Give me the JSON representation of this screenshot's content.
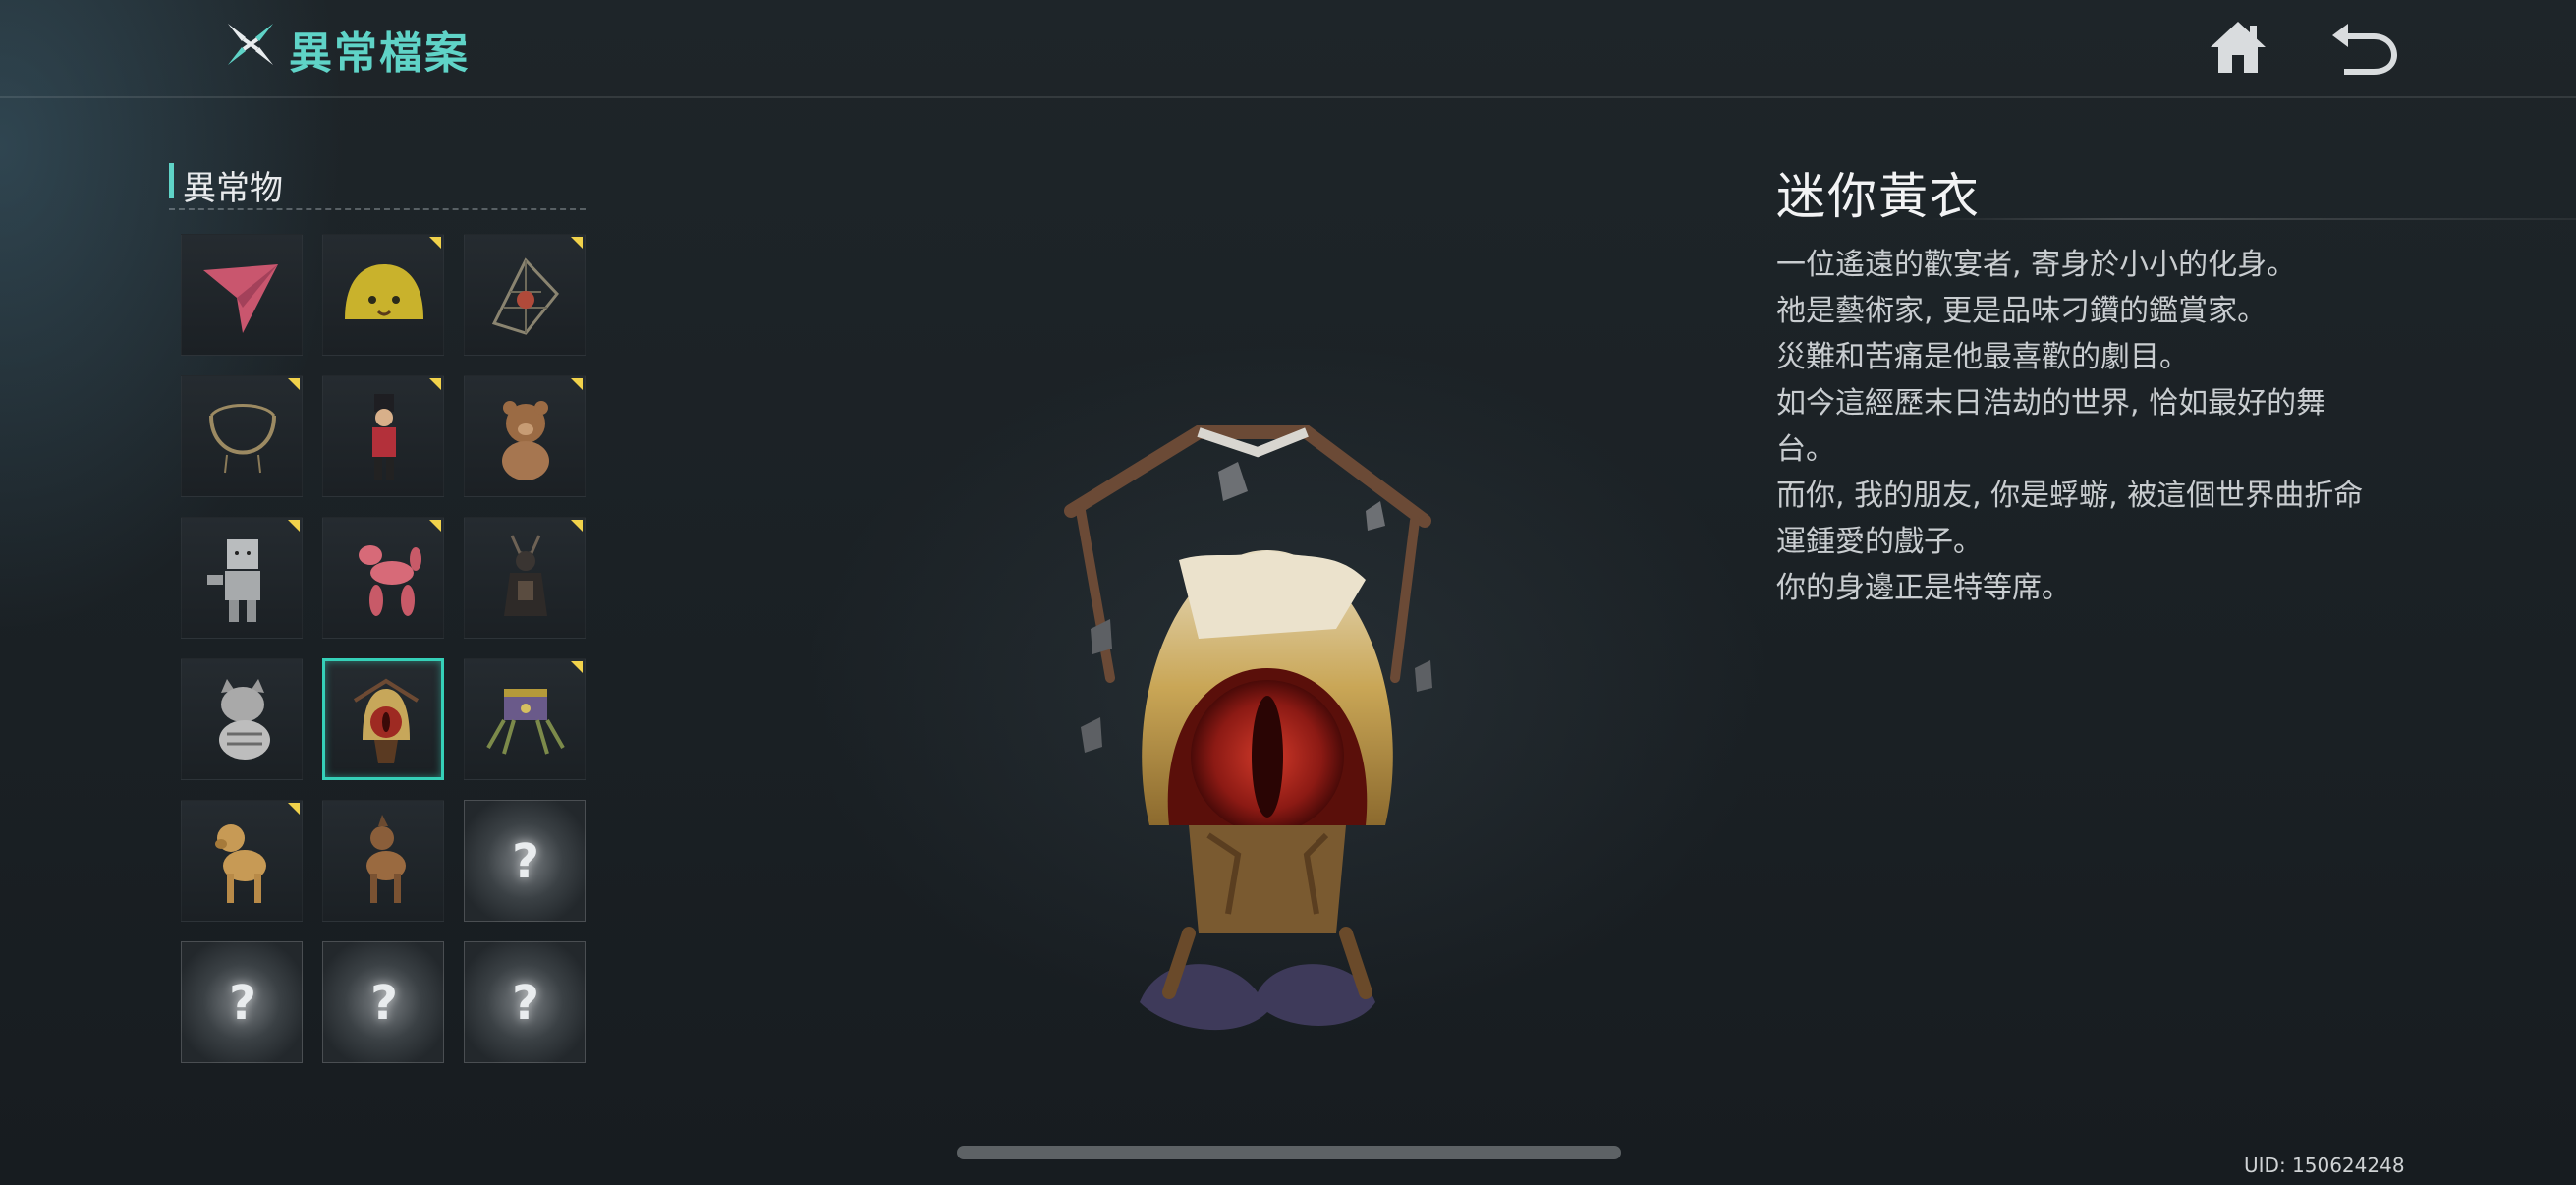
{
  "header": {
    "title": "異常檔案",
    "accent_color": "#5fd3c7",
    "logo_icon": "crossed-blades-icon",
    "home_icon": "home-icon",
    "back_icon": "back-arrow-icon"
  },
  "sidebar": {
    "category_label": "異常物",
    "items": [
      {
        "icon": "paper-plane-icon",
        "new": false,
        "locked": false,
        "selected": false
      },
      {
        "icon": "yellow-blob-icon",
        "new": true,
        "locked": false,
        "selected": false
      },
      {
        "icon": "lantern-cage-icon",
        "new": true,
        "locked": false,
        "selected": false
      },
      {
        "icon": "necklace-icon",
        "new": true,
        "locked": false,
        "selected": false
      },
      {
        "icon": "nutcracker-soldier-icon",
        "new": true,
        "locked": false,
        "selected": false
      },
      {
        "icon": "teddy-bear-icon",
        "new": true,
        "locked": false,
        "selected": false
      },
      {
        "icon": "box-robot-icon",
        "new": true,
        "locked": false,
        "selected": false
      },
      {
        "icon": "balloon-dog-icon",
        "new": true,
        "locked": false,
        "selected": false
      },
      {
        "icon": "dark-figure-icon",
        "new": true,
        "locked": false,
        "selected": false
      },
      {
        "icon": "tabby-cat-icon",
        "new": false,
        "locked": false,
        "selected": false
      },
      {
        "icon": "mini-yellow-robe-icon",
        "new": false,
        "locked": false,
        "selected": true
      },
      {
        "icon": "treasure-spider-icon",
        "new": true,
        "locked": false,
        "selected": false
      },
      {
        "icon": "labrador-dog-icon",
        "new": true,
        "locked": false,
        "selected": false
      },
      {
        "icon": "shepherd-dog-icon",
        "new": false,
        "locked": false,
        "selected": false
      },
      {
        "icon": "unknown-icon",
        "new": false,
        "locked": true,
        "selected": false,
        "label": "?"
      },
      {
        "icon": "unknown-icon",
        "new": false,
        "locked": true,
        "selected": false,
        "label": "?"
      },
      {
        "icon": "unknown-icon",
        "new": false,
        "locked": true,
        "selected": false,
        "label": "?"
      },
      {
        "icon": "unknown-icon",
        "new": false,
        "locked": true,
        "selected": false,
        "label": "?"
      }
    ]
  },
  "detail": {
    "name": "迷你黃衣",
    "lines": [
      "一位遙遠的歡宴者, 寄身於小小的化身。",
      "祂是藝術家, 更是品味刁鑽的鑑賞家。",
      "災難和苦痛是他最喜歡的劇目。",
      "如今這經歷末日浩劫的世界, 恰如最好的舞",
      "台。",
      "而你, 我的朋友, 你是蜉蝣, 被這個世界曲折命",
      "運鍾愛的戲子。",
      "你的身邊正是特等席。"
    ]
  },
  "footer": {
    "uid": "UID: 150624248"
  }
}
